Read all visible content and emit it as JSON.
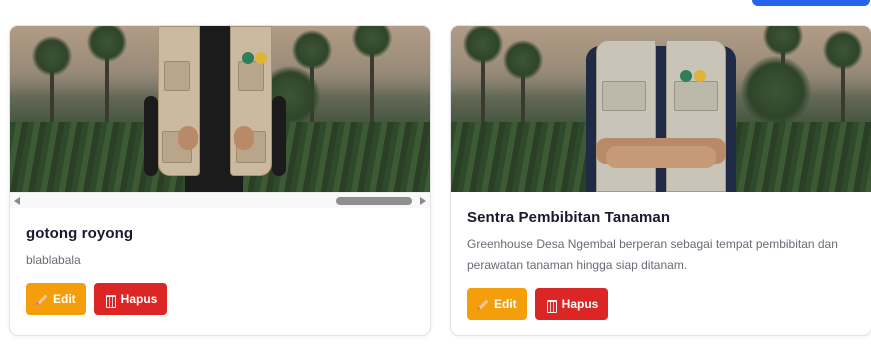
{
  "header": {
    "primary_action_label": ""
  },
  "cards": [
    {
      "title": "gotong royong",
      "description": "blablabala",
      "edit_label": "Edit",
      "delete_label": "Hapus"
    },
    {
      "title": "Sentra Pembibitan Tanaman",
      "description": "Greenhouse Desa Ngembal berperan sebagai tempat pembibitan dan perawatan tanaman hingga siap ditanam.",
      "edit_label": "Edit",
      "delete_label": "Hapus"
    }
  ],
  "icons": {
    "edit": "pencil-icon",
    "delete": "trash-icon"
  },
  "colors": {
    "edit_button": "#f59e0b",
    "delete_button": "#dc2626",
    "primary": "#2563eb"
  }
}
